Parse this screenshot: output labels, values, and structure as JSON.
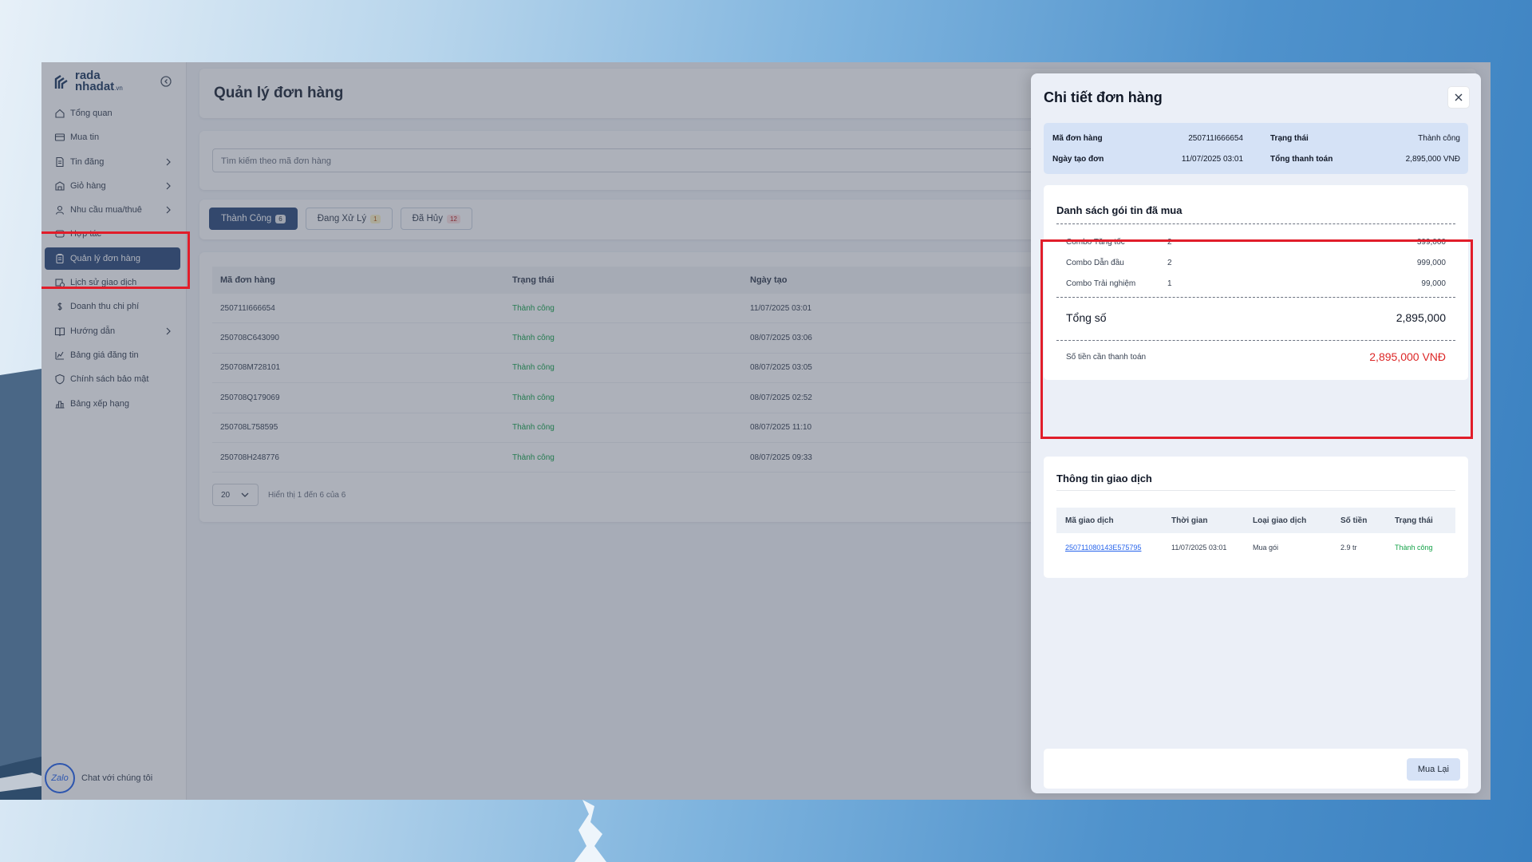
{
  "brand": {
    "logo_line1": "rada",
    "logo_line2": "nhadat",
    "logo_suffix": ".vn"
  },
  "sidebar": {
    "items": [
      {
        "label": "Tổng quan",
        "icon": "home-icon",
        "chevron": false
      },
      {
        "label": "Mua tin",
        "icon": "card-icon",
        "chevron": false
      },
      {
        "label": "Tin đăng",
        "icon": "document-icon",
        "chevron": true
      },
      {
        "label": "Giỏ hàng",
        "icon": "cart-icon",
        "chevron": true
      },
      {
        "label": "Nhu cầu mua/thuê",
        "icon": "user-icon",
        "chevron": true
      },
      {
        "label": "Hợp tác",
        "icon": "handshake-icon",
        "chevron": false
      },
      {
        "label": "Quản lý đơn hàng",
        "icon": "clipboard-icon",
        "chevron": false,
        "active": true
      },
      {
        "label": "Lịch sử giao dịch",
        "icon": "history-icon",
        "chevron": false
      },
      {
        "label": "Doanh thu chi phí",
        "icon": "dollar-icon",
        "chevron": false
      },
      {
        "label": "Hướng dẫn",
        "icon": "book-icon",
        "chevron": true
      },
      {
        "label": "Bảng giá đăng tin",
        "icon": "price-tag-icon",
        "chevron": false
      },
      {
        "label": "Chính sách bảo mật",
        "icon": "shield-icon",
        "chevron": false
      },
      {
        "label": "Bảng xếp hạng",
        "icon": "ranking-icon",
        "chevron": false
      }
    ],
    "chat_label": "Chat với chúng tôi",
    "zalo_label": "Zalo"
  },
  "main": {
    "title": "Quản lý đơn hàng",
    "search_placeholder": "Tìm kiếm theo mã đơn hàng",
    "tabs": [
      {
        "label": "Thành Công",
        "count": "6",
        "active": true
      },
      {
        "label": "Đang Xử Lý",
        "count": "1"
      },
      {
        "label": "Đã Hủy",
        "count": "12"
      }
    ],
    "table": {
      "headers": [
        "Mã đơn hàng",
        "Trạng thái",
        "Ngày tạo"
      ],
      "rows": [
        [
          "250711I666654",
          "Thành công",
          "11/07/2025 03:01"
        ],
        [
          "250708C643090",
          "Thành công",
          "08/07/2025 03:06"
        ],
        [
          "250708M728101",
          "Thành công",
          "08/07/2025 03:05"
        ],
        [
          "250708Q179069",
          "Thành công",
          "08/07/2025 02:52"
        ],
        [
          "250708L758595",
          "Thành công",
          "08/07/2025 11:10"
        ],
        [
          "250708H248776",
          "Thành công",
          "08/07/2025 09:33"
        ]
      ]
    },
    "pager": {
      "page_size": "20",
      "info": "Hiển thị 1 đến 6 của 6"
    }
  },
  "drawer": {
    "title": "Chi tiết đơn hàng",
    "summary": {
      "order_id_label": "Mã đơn hàng",
      "order_id": "250711I666654",
      "status_label": "Trạng thái",
      "status": "Thành công",
      "created_label": "Ngày tạo đơn",
      "created": "11/07/2025 03:01",
      "total_label": "Tổng thanh toán",
      "total": "2,895,000 VNĐ"
    },
    "packages": {
      "title": "Danh sách gói tin đã mua",
      "items": [
        {
          "name": "Combo Tăng tốc",
          "qty": "2",
          "price": "399,000"
        },
        {
          "name": "Combo Dẫn đầu",
          "qty": "2",
          "price": "999,000"
        },
        {
          "name": "Combo Trải nghiệm",
          "qty": "1",
          "price": "99,000"
        }
      ],
      "total_label": "Tổng số",
      "total_value": "2,895,000",
      "pay_label": "Số tiền cần thanh toán",
      "pay_value": "2,895,000 VNĐ"
    },
    "transactions": {
      "title": "Thông tin giao dịch",
      "headers": [
        "Mã giao dịch",
        "Thời gian",
        "Loại giao dịch",
        "Số tiền",
        "Trạng thái"
      ],
      "rows": [
        [
          "250711080143E575795",
          "11/07/2025 03:01",
          "Mua gói",
          "2.9 tr",
          "Thành công"
        ]
      ]
    },
    "buy_again_label": "Mua Lại"
  },
  "colors": {
    "accent": "#2d4a7a",
    "success": "#16a34a",
    "danger": "#dc2626",
    "highlight": "#e11d2a"
  }
}
